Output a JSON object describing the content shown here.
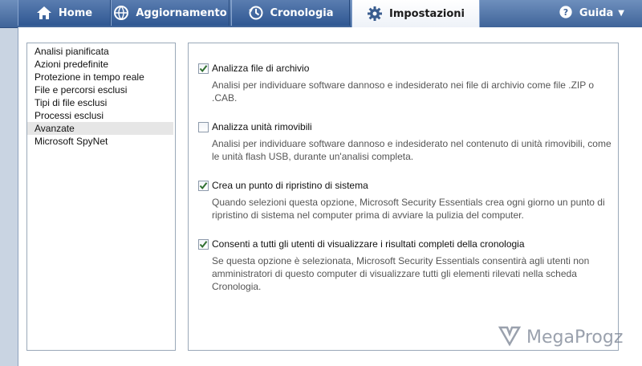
{
  "tabs": [
    {
      "label": "Home",
      "icon": "home-icon"
    },
    {
      "label": "Aggiornamento",
      "icon": "update-globe-icon"
    },
    {
      "label": "Cronologia",
      "icon": "history-icon"
    },
    {
      "label": "Impostazioni",
      "icon": "gear-icon",
      "active": true
    }
  ],
  "help": {
    "label": "Guida",
    "icon": "help-icon"
  },
  "nav": {
    "items": [
      "Analisi pianificata",
      "Azioni predefinite",
      "Protezione in tempo reale",
      "File e percorsi esclusi",
      "Tipi di file esclusi",
      "Processi esclusi",
      "Avanzate",
      "Microsoft SpyNet"
    ],
    "selected": "Avanzate"
  },
  "options": [
    {
      "label": "Analizza file di archivio",
      "checked": true,
      "description": "Analisi per individuare software dannoso e indesiderato nei file di archivio come file .ZIP o .CAB."
    },
    {
      "label": "Analizza unità rimovibili",
      "checked": false,
      "description": "Analisi per individuare software dannoso e indesiderato nel contenuto di unità rimovibili, come le unità flash USB, durante un'analisi completa."
    },
    {
      "label": "Crea un punto di ripristino di sistema",
      "checked": true,
      "description": "Quando selezioni questa opzione, Microsoft Security Essentials crea ogni giorno un punto di ripristino di sistema nel computer prima di avviare la pulizia del computer."
    },
    {
      "label": "Consenti a tutti gli utenti di visualizzare i risultati completi della cronologia",
      "checked": true,
      "description": "Se questa opzione è selezionata, Microsoft Security Essentials consentirà agli utenti non amministratori di questo computer di visualizzare tutti gli elementi rilevati nella scheda Cronologia."
    }
  ],
  "watermark": {
    "text": "MegaProgz"
  },
  "colors": {
    "tab_bar": "#3f6499",
    "check": "#2f6f2f",
    "panel": "#ffffff"
  }
}
